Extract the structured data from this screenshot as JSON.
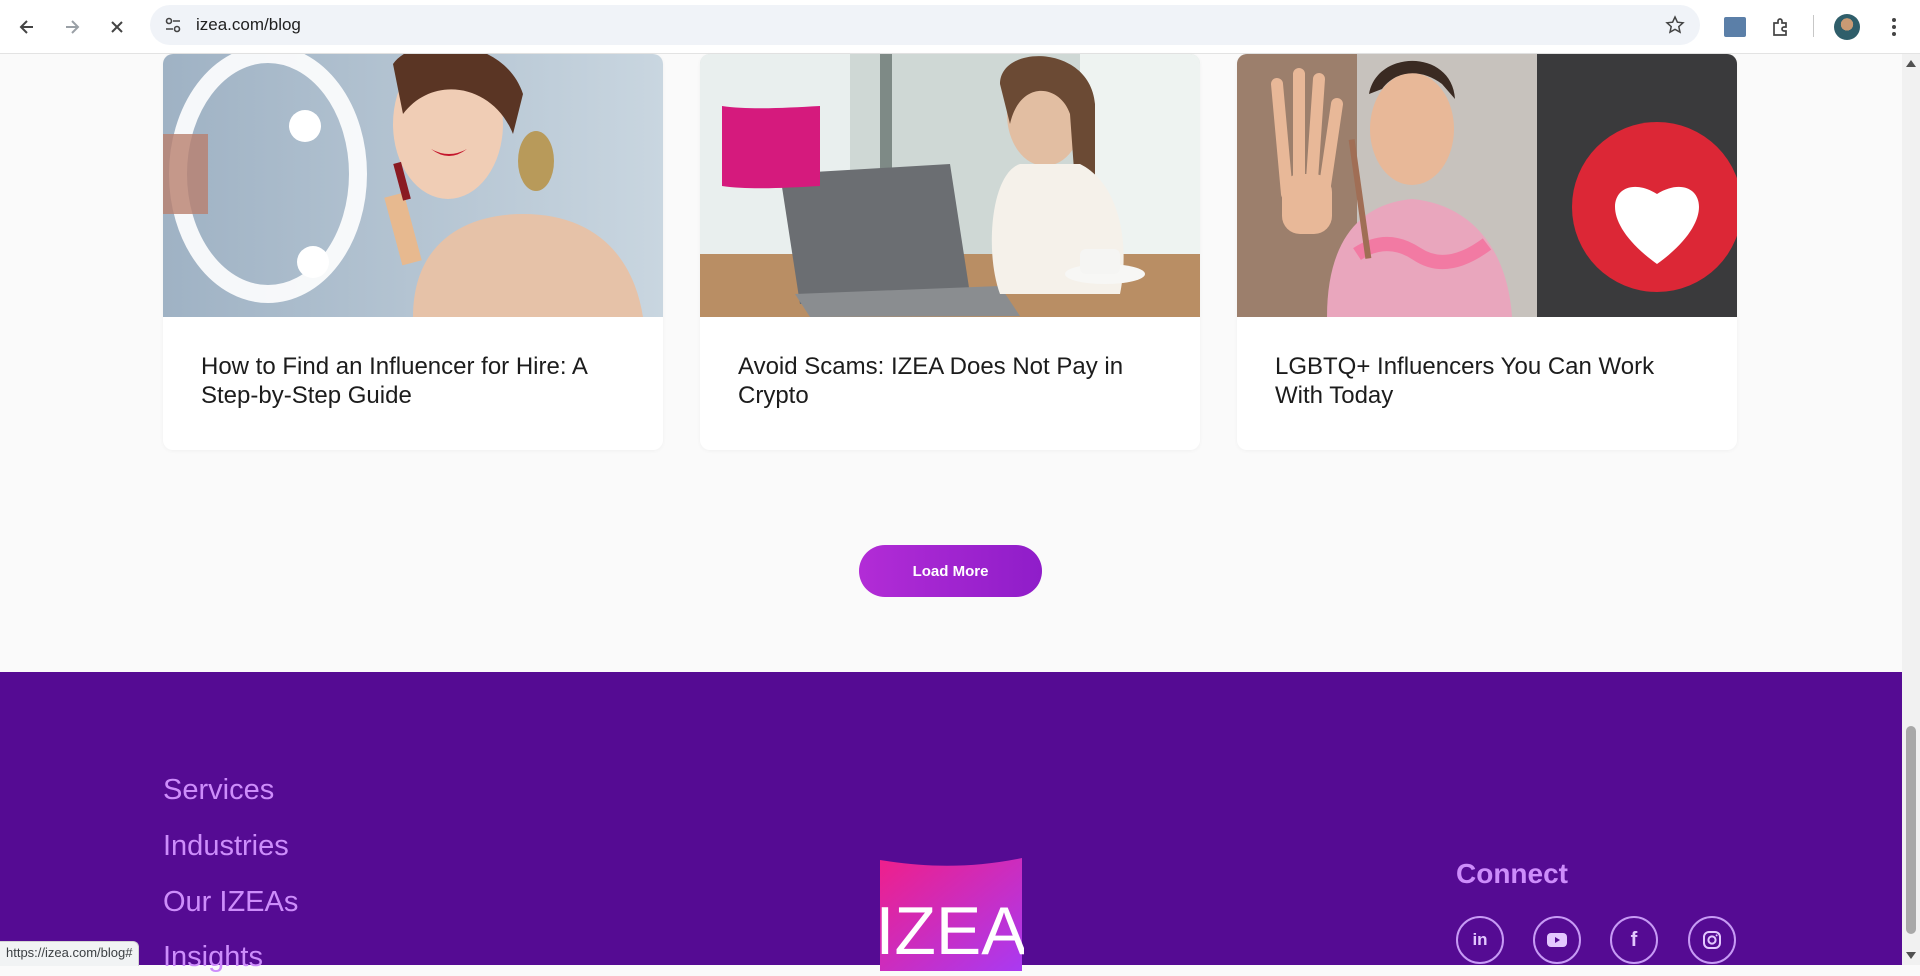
{
  "browser": {
    "url": "izea.com/blog",
    "status_url": "https://izea.com/blog#"
  },
  "posts": [
    {
      "title": "How to Find an Influencer for Hire: A Step-by-Step Guide"
    },
    {
      "title": "Avoid Scams: IZEA Does Not Pay in Crypto"
    },
    {
      "title": "LGBTQ+ Influencers You Can Work With Today"
    }
  ],
  "load_more_label": "Load More",
  "footer": {
    "links": [
      "Services",
      "Industries",
      "Our IZEAs",
      "Insights"
    ],
    "logo_text": "IZEA",
    "connect_heading": "Connect",
    "social": [
      "in",
      "youtube-icon",
      "f",
      "instagram-icon"
    ]
  },
  "colors": {
    "footer_bg": "#550b93",
    "footer_link": "#cd8dfb",
    "button_gradient_start": "#b22cd6",
    "button_gradient_end": "#8f1dc9"
  }
}
